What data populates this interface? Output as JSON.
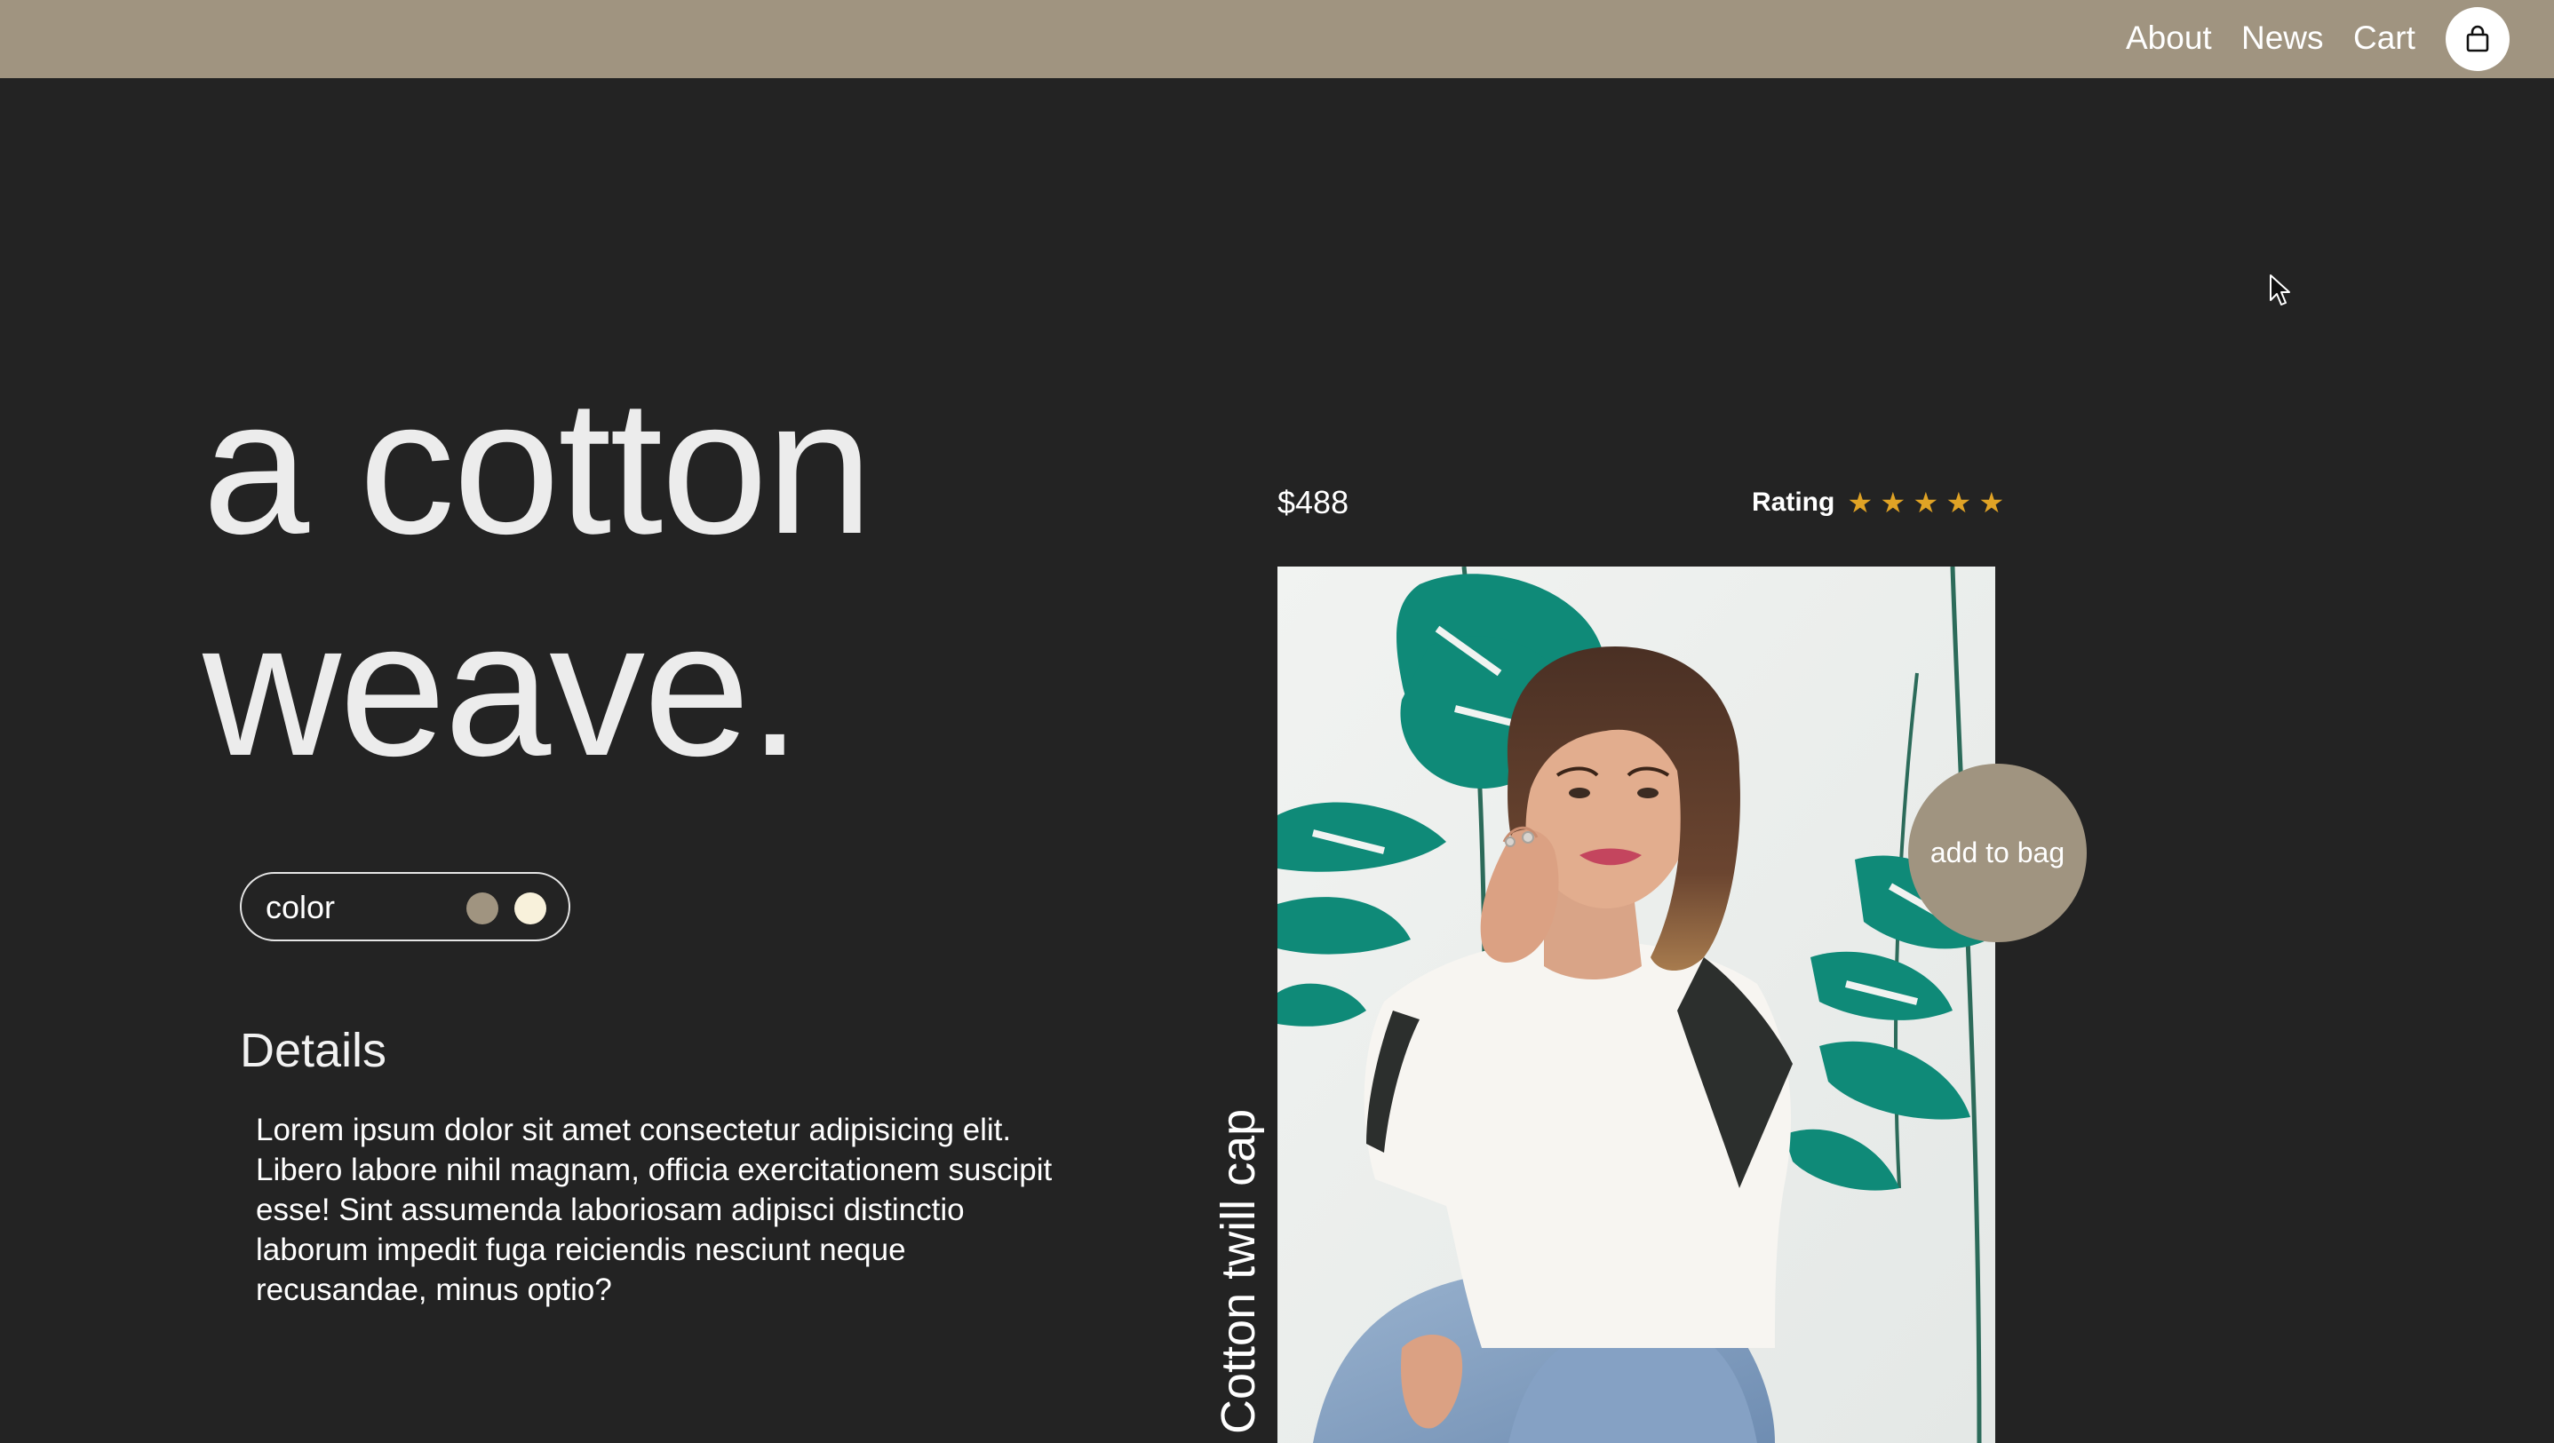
{
  "nav": {
    "links": [
      "About",
      "News",
      "Cart"
    ],
    "bag_icon": "shopping-bag-icon"
  },
  "hero": {
    "line1": "a cotton",
    "line2": "weave."
  },
  "color_picker": {
    "label": "color",
    "swatches": [
      "#a09480",
      "#f8f1db"
    ]
  },
  "details": {
    "title": "Details",
    "text": "Lorem ipsum dolor sit amet consectetur adipisicing elit. Libero labore nihil magnam, officia exercitationem suscipit esse! Sint assumenda laboriosam adipisci distinctio laborum impedit fuga reiciendis nesciunt neque recusandae, minus optio?"
  },
  "product": {
    "name": "Cotton twill cap",
    "price": "$488",
    "rating_label": "Rating",
    "rating": 5,
    "rating_max": 5,
    "add_button": "add to bag"
  },
  "colors": {
    "background": "#232323",
    "navbar": "#a09480",
    "accent": "#a09480",
    "star": "#e0a325"
  }
}
